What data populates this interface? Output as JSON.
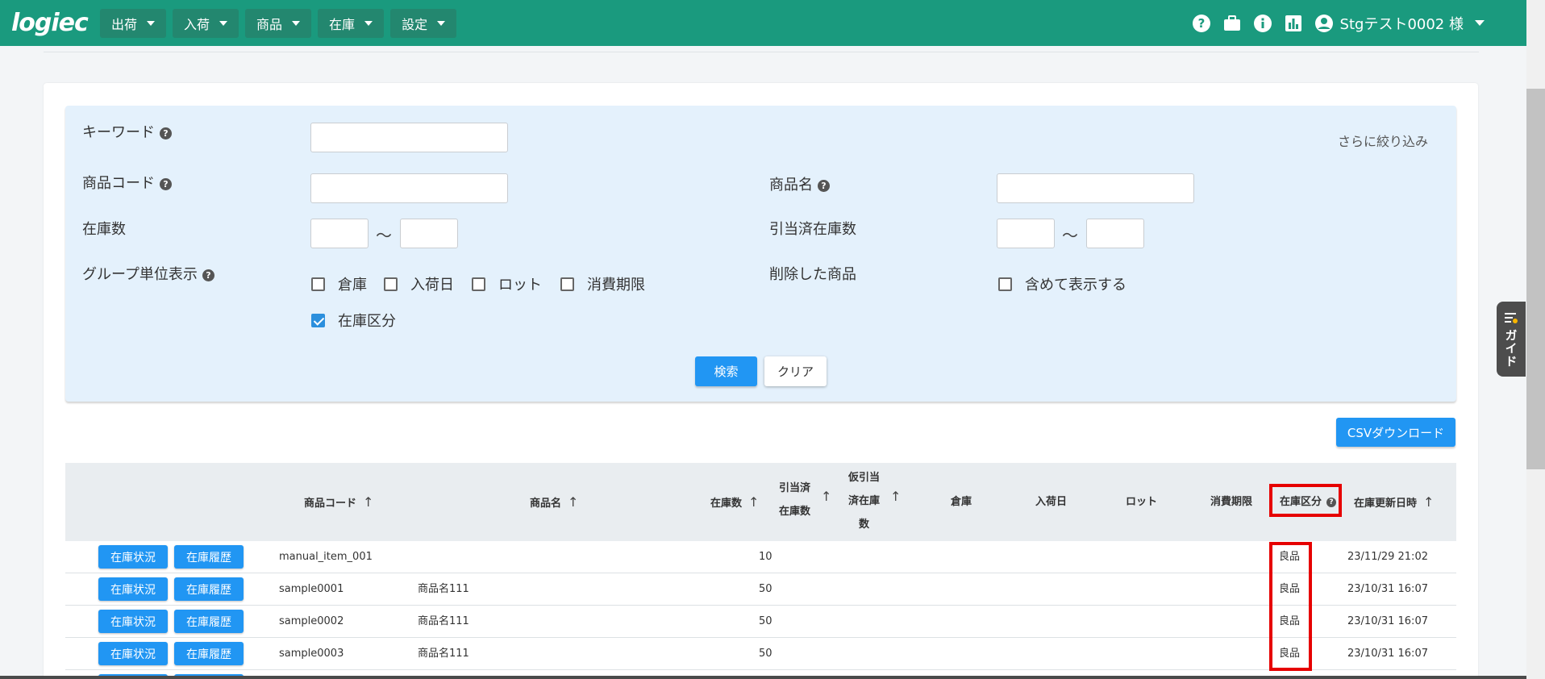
{
  "app": {
    "logo": "logiec"
  },
  "topbar": {
    "menus": [
      {
        "label": "出荷"
      },
      {
        "label": "入荷"
      },
      {
        "label": "商品"
      },
      {
        "label": "在庫"
      },
      {
        "label": "設定"
      }
    ],
    "icons": [
      "help-icon",
      "briefcase-icon",
      "info-icon",
      "chart-icon",
      "account-icon"
    ],
    "user": "Stgテスト0002 様"
  },
  "search": {
    "more_link": "さらに絞り込み",
    "keyword_label": "キーワード",
    "code_label": "商品コード",
    "name_label": "商品名",
    "stock_label": "在庫数",
    "allocated_label": "引当済在庫数",
    "group_label": "グループ単位表示",
    "deleted_label": "削除した商品",
    "tilde": "〜",
    "group_options": [
      {
        "label": "倉庫",
        "checked": false
      },
      {
        "label": "入荷日",
        "checked": false
      },
      {
        "label": "ロット",
        "checked": false
      },
      {
        "label": "消費期限",
        "checked": false
      },
      {
        "label": "在庫区分",
        "checked": true
      }
    ],
    "include_deleted": {
      "label": "含めて表示する",
      "checked": false
    },
    "search_button": "検索",
    "clear_button": "クリア",
    "help_glyph": "?"
  },
  "csv_button": "CSVダウンロード",
  "guide_tab": "ガイド",
  "table": {
    "headers": {
      "code": "商品コード",
      "name": "商品名",
      "stock": "在庫数",
      "allocated_1": "引当済",
      "allocated_2": "在庫数",
      "temp_1": "仮引当",
      "temp_2": "済在庫",
      "temp_3": "数",
      "warehouse": "倉庫",
      "arrival": "入荷日",
      "lot": "ロット",
      "expiry": "消費期限",
      "category": "在庫区分",
      "updated": "在庫更新日時"
    },
    "sort_arrow": "↑",
    "row_buttons": {
      "status": "在庫状況",
      "history": "在庫履歴"
    },
    "rows": [
      {
        "code": "manual_item_001",
        "name": "",
        "stock": "10",
        "category": "良品",
        "updated": "23/11/29 21:02"
      },
      {
        "code": "sample0001",
        "name": "商品名111",
        "stock": "50",
        "category": "良品",
        "updated": "23/10/31 16:07"
      },
      {
        "code": "sample0002",
        "name": "商品名111",
        "stock": "50",
        "category": "良品",
        "updated": "23/10/31 16:07"
      },
      {
        "code": "sample0003",
        "name": "商品名111",
        "stock": "50",
        "category": "良品",
        "updated": "23/10/31 16:07"
      }
    ]
  }
}
